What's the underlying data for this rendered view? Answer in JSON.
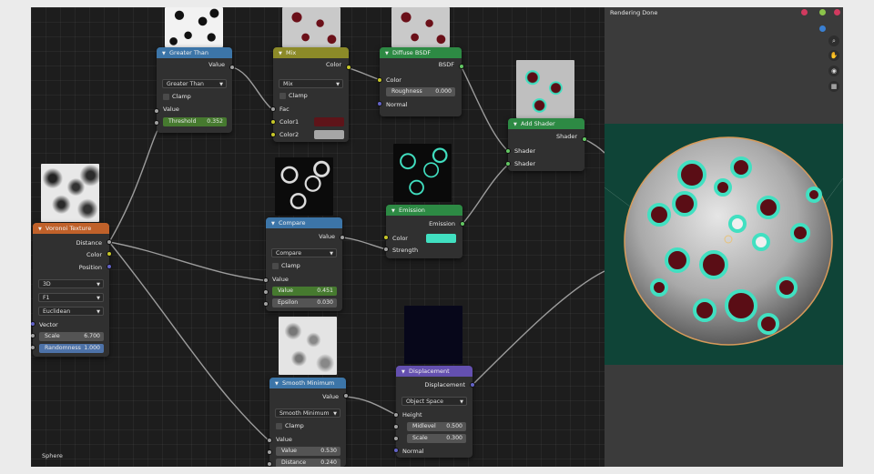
{
  "node_editor": {
    "status_object": "Sphere",
    "nodes": {
      "greater_than": {
        "title": "Greater Than",
        "output": "Value",
        "operation": "Greater Than",
        "clamp": "Clamp",
        "input": "Value",
        "threshold_label": "Threshold",
        "threshold_value": "0.352"
      },
      "mix": {
        "title": "Mix",
        "output": "Color",
        "blend": "Mix",
        "clamp": "Clamp",
        "fac": "Fac",
        "color1": "Color1",
        "color2": "Color2",
        "color1_hex": "#5e1419",
        "color2_hex": "#a6a6a6"
      },
      "diffuse": {
        "title": "Diffuse BSDF",
        "output": "BSDF",
        "color": "Color",
        "roughness_label": "Roughness",
        "roughness_value": "0.000",
        "normal": "Normal"
      },
      "add_shader": {
        "title": "Add Shader",
        "output": "Shader",
        "input1": "Shader",
        "input2": "Shader"
      },
      "voronoi": {
        "title": "Voronoi Texture",
        "out_distance": "Distance",
        "out_color": "Color",
        "out_position": "Position",
        "dimensions": "3D",
        "feature": "F1",
        "metric": "Euclidean",
        "vector": "Vector",
        "scale_label": "Scale",
        "scale_value": "6.700",
        "randomness_label": "Randomness",
        "randomness_value": "1.000"
      },
      "compare": {
        "title": "Compare",
        "output": "Value",
        "operation": "Compare",
        "clamp": "Clamp",
        "input": "Value",
        "value_label": "Value",
        "value_value": "0.451",
        "epsilon_label": "Epsilon",
        "epsilon_value": "0.030"
      },
      "emission": {
        "title": "Emission",
        "output": "Emission",
        "color": "Color",
        "strength": "Strength",
        "color_hex": "#41e0c1"
      },
      "smooth_min": {
        "title": "Smooth Minimum",
        "output": "Value",
        "operation": "Smooth Minimum",
        "clamp": "Clamp",
        "input": "Value",
        "value_label": "Value",
        "value_value": "0.530",
        "distance_label": "Distance",
        "distance_value": "0.240"
      },
      "displacement": {
        "title": "Displacement",
        "output": "Displacement",
        "space": "Object Space",
        "height": "Height",
        "midlevel_label": "Midlevel",
        "midlevel_value": "0.500",
        "scale_label": "Scale",
        "scale_value": "0.300",
        "normal": "Normal"
      }
    }
  },
  "viewport": {
    "render_status": "Rendering Done",
    "nav_icons": [
      "zoom-icon",
      "hand-pan-icon",
      "camera-icon",
      "grid-icon"
    ],
    "gizmo_colors": [
      "#d13a5f",
      "#8bc34a",
      "#3a7fd1"
    ],
    "background_color": "#0f4437",
    "emission_color": "#41e0c1"
  }
}
